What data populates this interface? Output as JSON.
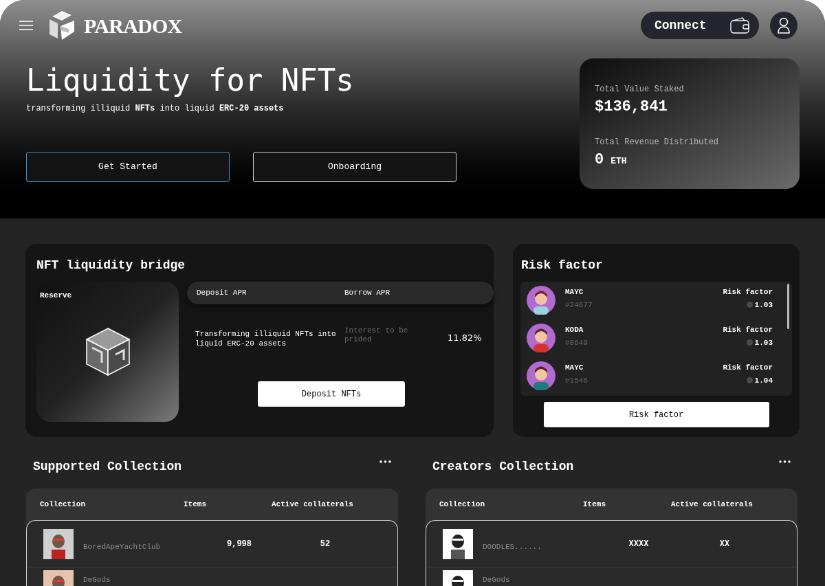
{
  "header": {
    "brand": "PARADOX",
    "connect_button": "Connect"
  },
  "hero": {
    "title": "Liquidity for NFTs",
    "subtitle": "transforming illiquid **NFTs** into liquid **ERC-20 assets**",
    "buttons": [
      {
        "label": "Get Started",
        "focused": true
      },
      {
        "label": "Onboarding",
        "focused": false
      }
    ]
  },
  "stats": [
    {
      "label": "Total Value Staked",
      "value": "$136,841"
    },
    {
      "label": "Total Revenue Distributed",
      "value": "0",
      "unit": "ETH"
    }
  ],
  "bridge": {
    "title": "NFT liquidity bridge",
    "reserve_label": "Reserve",
    "columns": [
      "Deposit APR",
      "Borrow APR"
    ],
    "description": "Transforming illiquid NFTs into liquid ERC-20 assets",
    "interest_note": "Interest to be prided",
    "rate": "11.82%",
    "button": "Deposit NFTs"
  },
  "risk": {
    "title": "Risk factor",
    "items": [
      {
        "name": "MAYC",
        "id": "#24677",
        "label": "Risk factor",
        "value": "1.03"
      },
      {
        "name": "KODA",
        "id": "#8649",
        "label": "Risk factor",
        "value": "1.03"
      },
      {
        "name": "MAYC",
        "id": "#1546",
        "label": "Risk factor",
        "value": "1.04"
      }
    ],
    "button": "Risk factor"
  },
  "collections": [
    {
      "title": "Supported Collection",
      "columns": [
        "Collection",
        "Items",
        "Active collaterals"
      ],
      "rows": [
        {
          "name": "BoredApeYachtClub",
          "items": "9,998",
          "active": "52"
        },
        {
          "name": "DeGods"
        }
      ]
    },
    {
      "title": "Creators Collection",
      "columns": [
        "Collection",
        "Items",
        "Active collaterals"
      ],
      "rows": [
        {
          "name": "DOODLES......",
          "items": "XXXX",
          "active": "XX"
        },
        {
          "name": "DeGods"
        }
      ]
    }
  ]
}
